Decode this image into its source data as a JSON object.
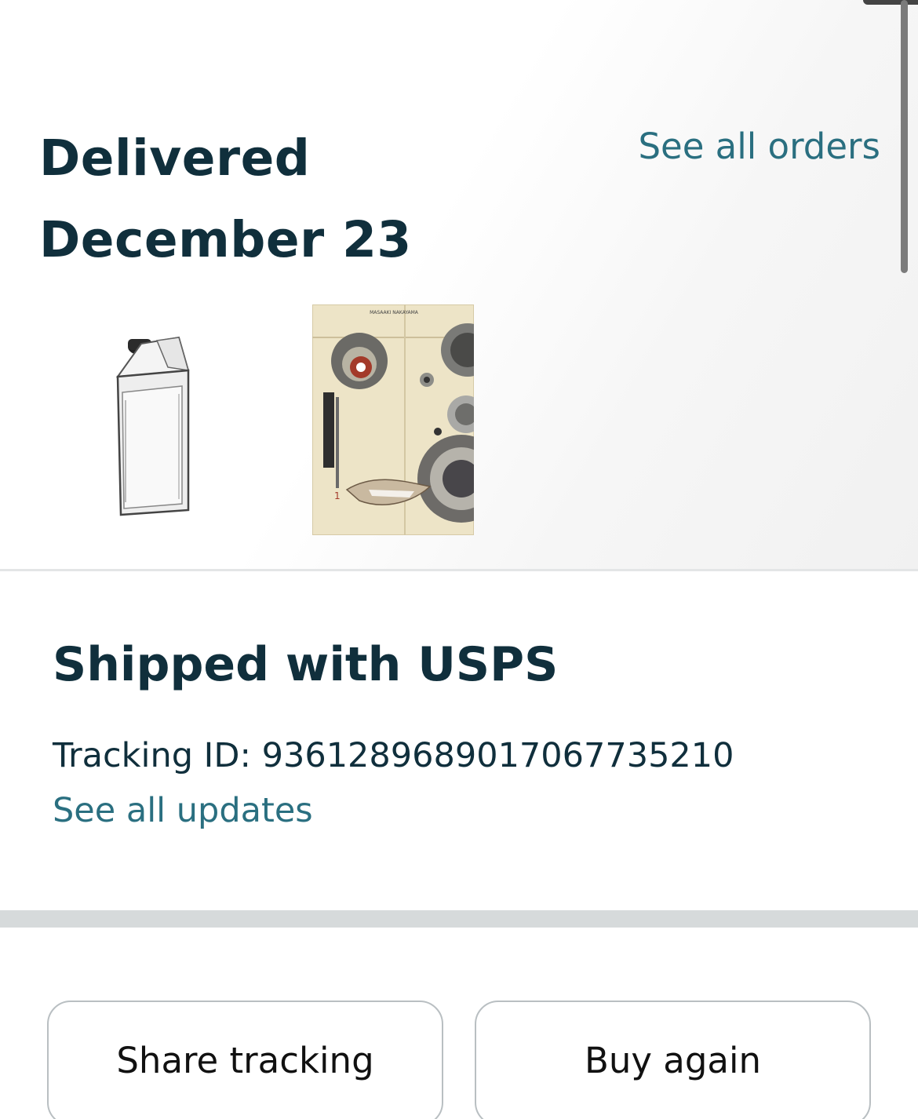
{
  "delivery": {
    "status_line1": "Delivered",
    "status_line2": "December 23",
    "see_all_orders": "See all orders"
  },
  "products": [
    {
      "name": "milk-carton-water-bottle",
      "icon": "bottle-image"
    },
    {
      "name": "manga-book-cover",
      "icon": "book-cover-image",
      "cover_text": "MASAAKI NAKAYAMA",
      "volume": "1"
    }
  ],
  "shipping": {
    "title": "Shipped with USPS",
    "tracking_label": "Tracking ID: 9361289689017067735210",
    "see_updates": "See all updates"
  },
  "actions": {
    "share_label": "Share tracking",
    "buy_again_label": "Buy again"
  }
}
